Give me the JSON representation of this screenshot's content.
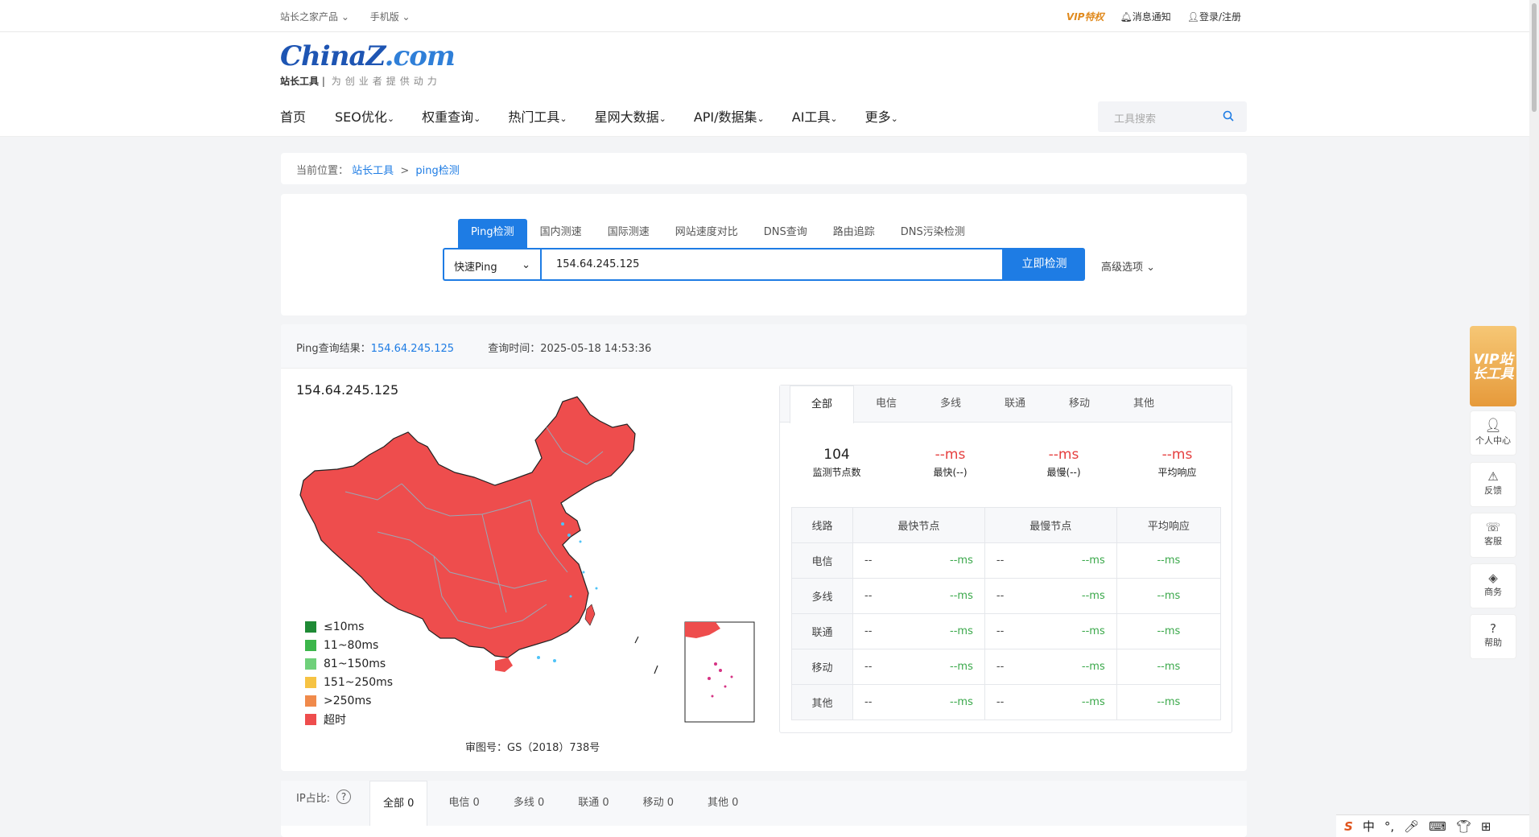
{
  "topbar": {
    "products": "站长之家产品",
    "mobile": "手机版",
    "vip": "VIP特权",
    "notify": "消息通知",
    "login": "登录/注册"
  },
  "logo": {
    "main": "ChinaZ",
    "dotcom": ".com",
    "sub_bold": "站长工具",
    "slogan": "为创业者提供动力"
  },
  "nav": {
    "items": [
      "首页",
      "SEO优化",
      "权重查询",
      "热门工具",
      "星网大数据",
      "API/数据集",
      "AI工具",
      "更多"
    ]
  },
  "search": {
    "placeholder": "工具搜索"
  },
  "breadcrumb": {
    "label": "当前位置：",
    "home": "站长工具",
    "sep": ">",
    "current": "ping检测"
  },
  "tool": {
    "tabs": [
      "Ping检测",
      "国内测速",
      "国际测速",
      "网站速度对比",
      "DNS查询",
      "路由追踪",
      "DNS污染检测"
    ],
    "mode": "快速Ping",
    "input": "154.64.245.125",
    "submit": "立即检测",
    "advanced": "高级选项"
  },
  "result": {
    "label": "Ping查询结果：",
    "ip": "154.64.245.125",
    "time_label": "查询时间：",
    "time": "2025-05-18 14:53:36",
    "map_title": "154.64.245.125",
    "map_approval": "审图号：GS（2018）738号",
    "legend": [
      {
        "label": "≤10ms",
        "color": "#1f8a35"
      },
      {
        "label": "11~80ms",
        "color": "#3cb64b"
      },
      {
        "label": "81~150ms",
        "color": "#6fd07a"
      },
      {
        "label": "151~250ms",
        "color": "#f6c343"
      },
      {
        "label": ">250ms",
        "color": "#f08a4b"
      },
      {
        "label": "超时",
        "color": "#ee4d4d"
      }
    ],
    "map_fill": "#ee4d4d"
  },
  "stats": {
    "tabs": [
      "全部",
      "电信",
      "多线",
      "联通",
      "移动",
      "其他"
    ],
    "kpis": [
      {
        "value": "104",
        "label": "监测节点数"
      },
      {
        "value": "--ms",
        "label": "最快(--)"
      },
      {
        "value": "--ms",
        "label": "最慢(--)"
      },
      {
        "value": "--ms",
        "label": "平均响应"
      }
    ],
    "headers": [
      "线路",
      "最快节点",
      "最慢节点",
      "平均响应"
    ],
    "rows": [
      {
        "line": "电信",
        "fast_node": "--",
        "fast_ms": "--ms",
        "slow_node": "--",
        "slow_ms": "--ms",
        "avg": "--ms"
      },
      {
        "line": "多线",
        "fast_node": "--",
        "fast_ms": "--ms",
        "slow_node": "--",
        "slow_ms": "--ms",
        "avg": "--ms"
      },
      {
        "line": "联通",
        "fast_node": "--",
        "fast_ms": "--ms",
        "slow_node": "--",
        "slow_ms": "--ms",
        "avg": "--ms"
      },
      {
        "line": "移动",
        "fast_node": "--",
        "fast_ms": "--ms",
        "slow_node": "--",
        "slow_ms": "--ms",
        "avg": "--ms"
      },
      {
        "line": "其他",
        "fast_node": "--",
        "fast_ms": "--ms",
        "slow_node": "--",
        "slow_ms": "--ms",
        "avg": "--ms"
      }
    ]
  },
  "ip_ratio": {
    "label": "IP占比:",
    "tabs": [
      "全部 0",
      "电信 0",
      "多线 0",
      "联通 0",
      "移动 0",
      "其他 0"
    ]
  },
  "side": {
    "vip": "VIP站长工具",
    "items": [
      "个人中心",
      "反馈",
      "客服",
      "商务",
      "帮助"
    ]
  },
  "ime": {
    "chars": [
      "中",
      "°,",
      "⌨",
      "⊞"
    ]
  }
}
